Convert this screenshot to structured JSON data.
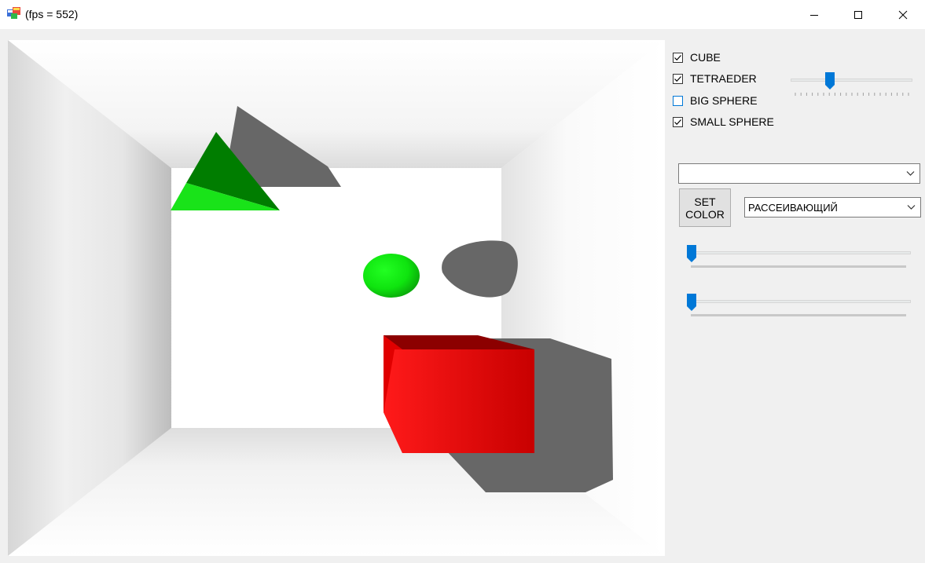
{
  "window": {
    "title": "(fps = 552)",
    "controls": [
      "minimize",
      "maximize",
      "close"
    ]
  },
  "checkboxes": [
    {
      "label": "CUBE",
      "checked": true
    },
    {
      "label": "TETRAEDER",
      "checked": true
    },
    {
      "label": "BIG SPHERE",
      "checked": false
    },
    {
      "label": "SMALL SPHERE",
      "checked": true
    }
  ],
  "tetra_slider": {
    "value_fraction": 0.31
  },
  "object_combo": {
    "value": ""
  },
  "set_color": {
    "line1": "SET",
    "line2": "COLOR"
  },
  "light_combo": {
    "value": "РАССЕИВАЮЩИЙ"
  },
  "slider_1": {
    "value_fraction": 0.0
  },
  "slider_2": {
    "value_fraction": 0.0
  },
  "colors": {
    "accent": "#0078d7",
    "cube": "#e60000",
    "tetra_dark": "#007800",
    "tetra_light": "#18e418",
    "sphere": "#10e010",
    "shadow": "#676767"
  },
  "icons": {
    "app": "app-icon",
    "minimize": "minimize-icon",
    "maximize": "maximize-icon",
    "close": "close-icon",
    "combo_arrow": "chevron-down-icon",
    "check": "check-icon"
  }
}
